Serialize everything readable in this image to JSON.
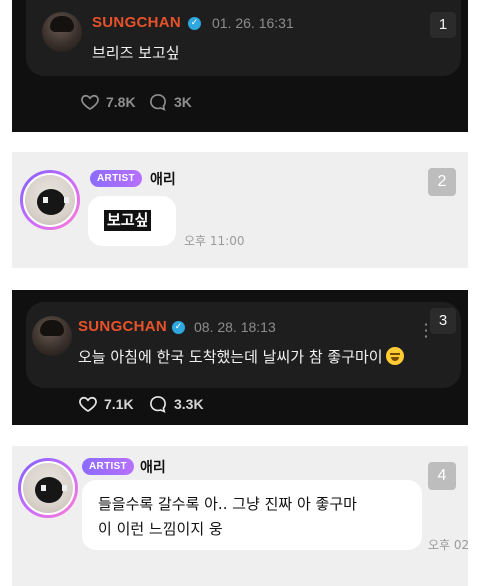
{
  "posts": [
    {
      "name": "SUNGCHAN",
      "date": "01. 26. 16:31",
      "text": "브리즈 보고싶",
      "likes": "7.8K",
      "comments": "3K",
      "number": "1"
    },
    {
      "badge": "ARTIST",
      "name": "애리",
      "text": "보고싶",
      "time": "오후 11:00",
      "number": "2"
    },
    {
      "name": "SUNGCHAN",
      "date": "08. 28. 18:13",
      "text": "오늘 아침에 한국 도착했는데 날씨가 참 좋구마이",
      "likes": "7.1K",
      "comments": "3.3K",
      "number": "3"
    },
    {
      "badge": "ARTIST",
      "name": "애리",
      "text_line1": "들을수록 갈수록 아.. 그냥 진짜 아 좋구마",
      "text_line2": "이 이런 느낌이지 웅",
      "time": "오후 02",
      "number": "4"
    }
  ],
  "icons": {
    "verified": "verified-check-icon",
    "like": "heart-icon",
    "comment": "speech-bubble-icon",
    "more": "kebab-menu-icon",
    "emoji": "grinning-squint-emoji"
  },
  "colors": {
    "name_accent": "#e8522a",
    "verified": "#2ea7e0",
    "artist_badge": "#8a6cff"
  }
}
